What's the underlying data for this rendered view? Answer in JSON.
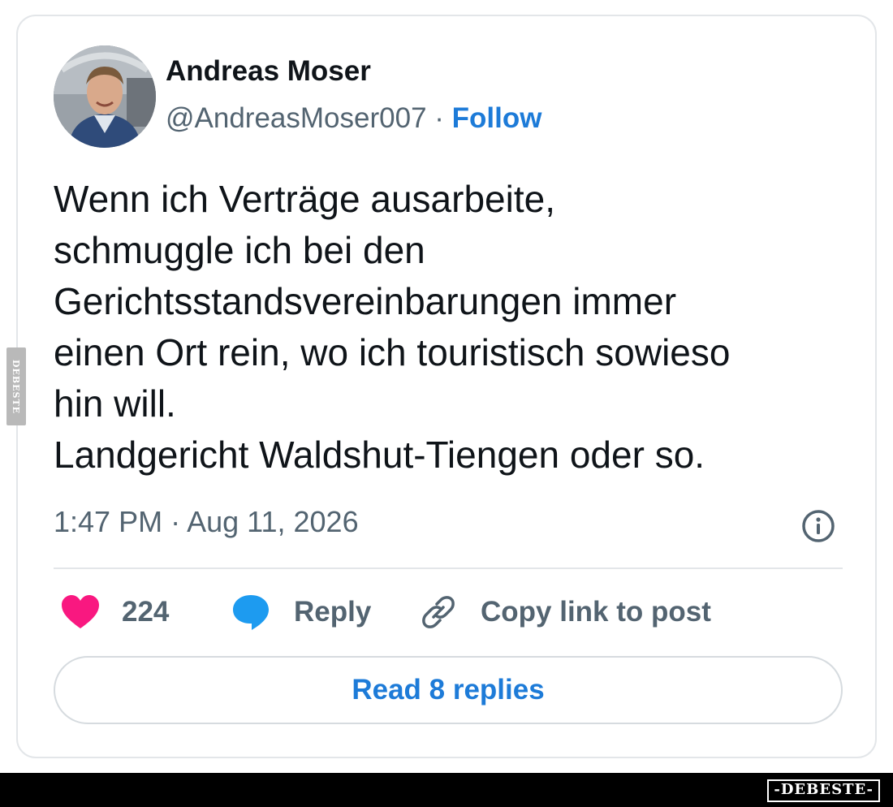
{
  "author": {
    "name": "Andreas Moser",
    "handle": "@AndreasMoser007",
    "separator": "·",
    "follow_label": "Follow"
  },
  "tweet": {
    "lines": [
      "Wenn ich Verträge ausarbeite,",
      "schmuggle ich bei den",
      "Gerichtsstandsvereinbarungen immer",
      "einen Ort rein, wo ich touristisch sowieso",
      "hin will.",
      "Landgericht Waldshut-Tiengen oder so."
    ],
    "timestamp": "1:47 PM · Aug 11, 2026"
  },
  "actions": {
    "like_count": "224",
    "reply_label": "Reply",
    "copy_label": "Copy link to post"
  },
  "read_replies_label": "Read 8 replies",
  "watermark": {
    "side_text": "DEBESTE",
    "badge_text": "-DEBESTE-"
  },
  "colors": {
    "accent": "#1d7bd8",
    "heart": "#f91880",
    "reply_bubble": "#1d9bf0",
    "muted_text": "#536471"
  },
  "icons": {
    "like": "heart-icon",
    "reply": "speech-bubble-icon",
    "copy": "link-icon",
    "info": "info-circle-icon"
  }
}
